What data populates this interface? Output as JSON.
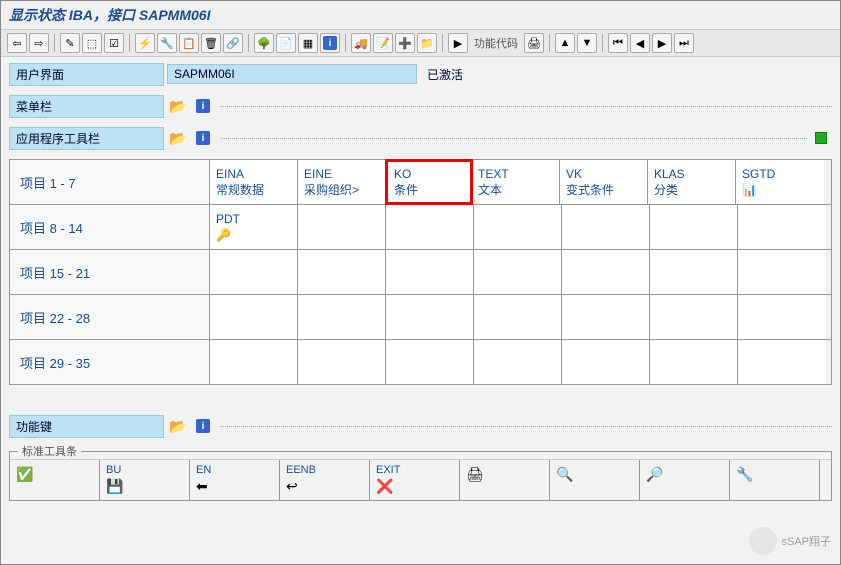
{
  "title": "显示状态 IBA，接口 SAPMM06I",
  "toolbar": {
    "func_code_label": "功能代码"
  },
  "form": {
    "user_interface_label": "用户界面",
    "user_interface_value": "SAPMM06I",
    "status_text": "已激活",
    "menu_label": "菜单栏",
    "app_toolbar_label": "应用程序工具栏"
  },
  "grid": {
    "rows": [
      {
        "label": "项目  1 -  7",
        "cells": [
          {
            "code": "EINA",
            "desc": "常规数据"
          },
          {
            "code": "EINE",
            "desc": "采购组织>"
          },
          {
            "code": "KO",
            "desc": "条件",
            "highlight": true
          },
          {
            "code": "TEXT",
            "desc": "文本"
          },
          {
            "code": "VK",
            "desc": "变式条件"
          },
          {
            "code": "KLAS",
            "desc": "分类"
          },
          {
            "code": "SGTD",
            "desc": "",
            "icon": "📊"
          }
        ]
      },
      {
        "label": "项目  8 - 14",
        "cells": [
          {
            "code": "PDT",
            "desc": "",
            "icon": "🔑"
          },
          {
            "code": "",
            "desc": ""
          },
          {
            "code": "",
            "desc": ""
          },
          {
            "code": "",
            "desc": ""
          },
          {
            "code": "",
            "desc": ""
          },
          {
            "code": "",
            "desc": ""
          },
          {
            "code": "",
            "desc": ""
          }
        ]
      },
      {
        "label": "项目 15 - 21",
        "cells": [
          {
            "code": "",
            "desc": ""
          },
          {
            "code": "",
            "desc": ""
          },
          {
            "code": "",
            "desc": ""
          },
          {
            "code": "",
            "desc": ""
          },
          {
            "code": "",
            "desc": ""
          },
          {
            "code": "",
            "desc": ""
          },
          {
            "code": "",
            "desc": ""
          }
        ]
      },
      {
        "label": "项目 22 - 28",
        "cells": [
          {
            "code": "",
            "desc": ""
          },
          {
            "code": "",
            "desc": ""
          },
          {
            "code": "",
            "desc": ""
          },
          {
            "code": "",
            "desc": ""
          },
          {
            "code": "",
            "desc": ""
          },
          {
            "code": "",
            "desc": ""
          },
          {
            "code": "",
            "desc": ""
          }
        ]
      },
      {
        "label": "项目 29 - 35",
        "cells": [
          {
            "code": "",
            "desc": ""
          },
          {
            "code": "",
            "desc": ""
          },
          {
            "code": "",
            "desc": ""
          },
          {
            "code": "",
            "desc": ""
          },
          {
            "code": "",
            "desc": ""
          },
          {
            "code": "",
            "desc": ""
          },
          {
            "code": "",
            "desc": ""
          }
        ]
      }
    ]
  },
  "func_section": {
    "label": "功能键",
    "legend": "标准工具条"
  },
  "func_keys": [
    {
      "label": "",
      "icon": "✅"
    },
    {
      "label": "BU",
      "icon": "💾"
    },
    {
      "label": "EN",
      "icon": "⬅"
    },
    {
      "label": "EENB",
      "icon": "↩"
    },
    {
      "label": "EXIT",
      "icon": "❌"
    },
    {
      "label": "",
      "icon": "🖨"
    },
    {
      "label": "",
      "icon": "🔍"
    },
    {
      "label": "",
      "icon": "🔎"
    },
    {
      "label": "",
      "icon": "🔧"
    }
  ],
  "watermark": "sSAP翔子"
}
